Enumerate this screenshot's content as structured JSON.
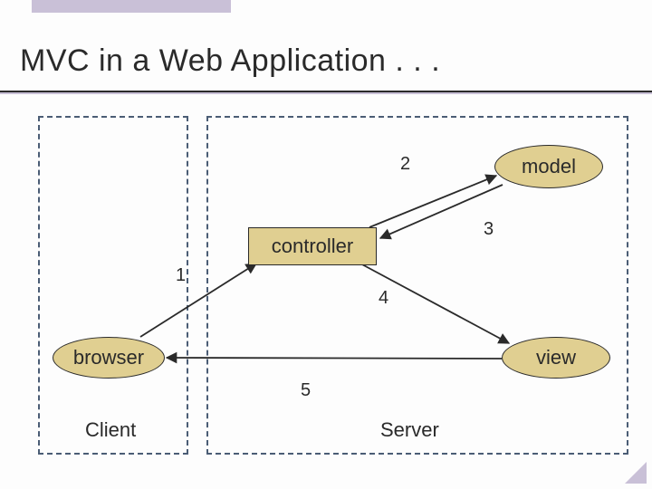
{
  "title": "MVC in a Web Application . . .",
  "groups": {
    "client": "Client",
    "server": "Server"
  },
  "nodes": {
    "browser": "browser",
    "controller": "controller",
    "model": "model",
    "view": "view"
  },
  "edges": {
    "n1": "1",
    "n2": "2",
    "n3": "3",
    "n4": "4",
    "n5": "5"
  }
}
